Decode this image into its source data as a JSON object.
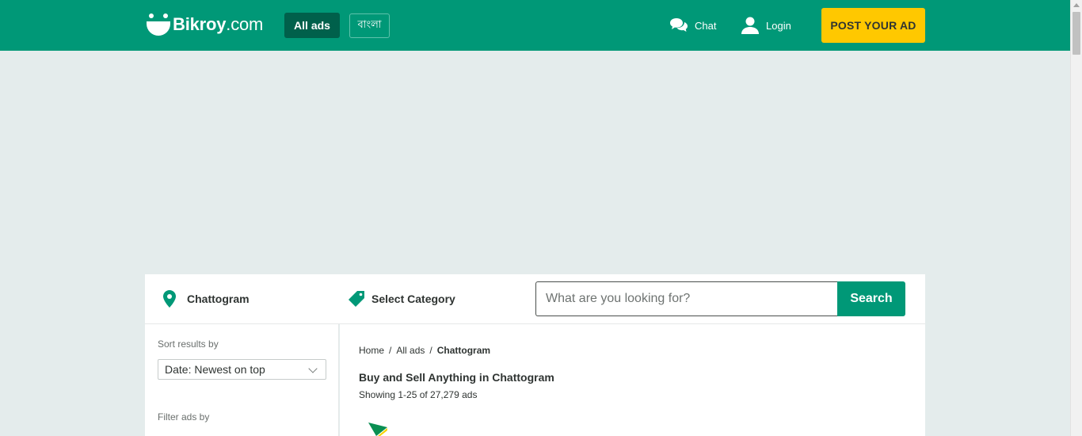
{
  "header": {
    "logo_name": "Bikroy",
    "logo_tld": ".com",
    "all_ads_label": "All ads",
    "language_label": "বাংলা",
    "chat_label": "Chat",
    "login_label": "Login",
    "post_ad_label": "POST YOUR AD",
    "icons": {
      "logo": "bikroy-smile-icon",
      "chat": "chat-bubbles-icon",
      "login": "user-icon"
    }
  },
  "search": {
    "location": "Chattogram",
    "category": "Select Category",
    "placeholder": "What are you looking for?",
    "button_label": "Search",
    "icons": {
      "location": "map-pin-icon",
      "category": "tag-icon"
    }
  },
  "sidebar": {
    "sort_label": "Sort results by",
    "sort_value": "Date: Newest on top",
    "filter_label": "Filter ads by"
  },
  "main": {
    "breadcrumb": [
      "Home",
      "All ads",
      "Chattogram"
    ],
    "title": "Buy and Sell Anything in Chattogram",
    "result_count": "Showing 1-25 of 27,279 ads"
  },
  "colors": {
    "brand_green": "#009877",
    "dark_green": "#00604b",
    "accent_yellow": "#ffc800",
    "page_bg": "#e4ecec"
  }
}
